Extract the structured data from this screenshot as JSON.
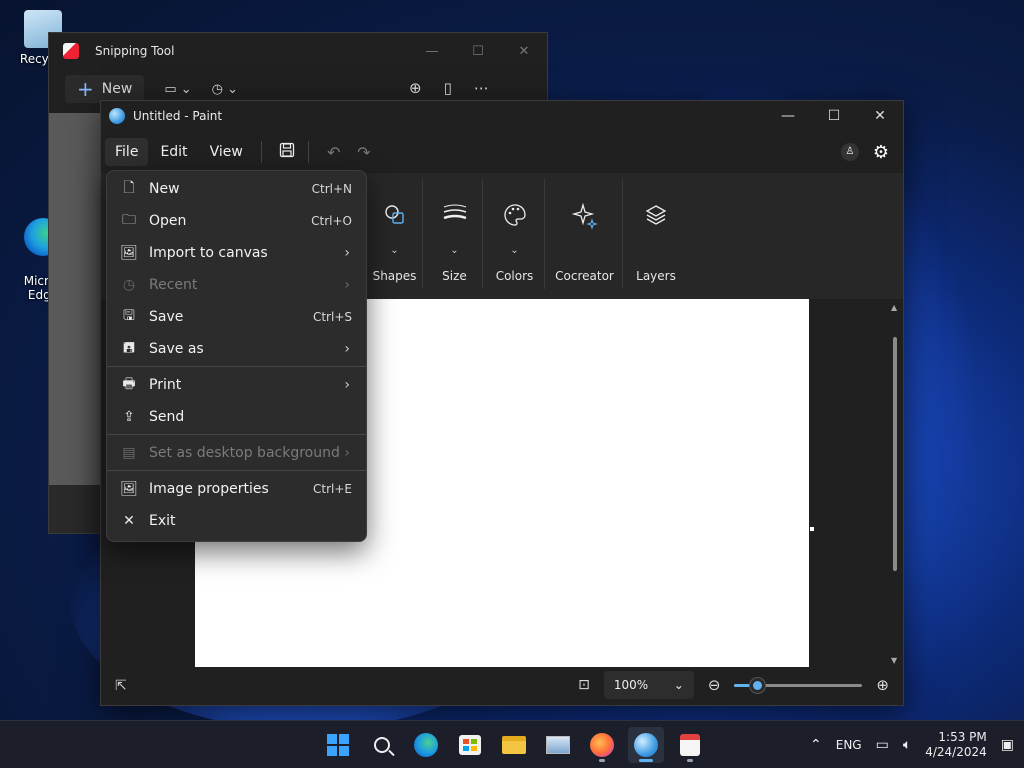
{
  "desktop": {
    "icons": [
      {
        "label": "Recycle"
      },
      {
        "label": "Micros\nEdge"
      }
    ]
  },
  "snipping_tool": {
    "title": "Snipping Tool",
    "new_label": "New",
    "toolbar_icons": [
      "rectangle-snip-icon",
      "timer-icon",
      "zoom-in-icon",
      "copy-icon",
      "more-icon"
    ]
  },
  "paint": {
    "title": "Untitled - Paint",
    "menu": {
      "file": "File",
      "edit": "Edit",
      "view": "View"
    },
    "ribbon": [
      {
        "label": "Shapes",
        "icon": "shapes-icon"
      },
      {
        "label": "Size",
        "icon": "brush-size-icon"
      },
      {
        "label": "Colors",
        "icon": "palette-icon"
      },
      {
        "label": "Cocreator",
        "icon": "sparkle-icon"
      },
      {
        "label": "Layers",
        "icon": "layers-icon"
      }
    ],
    "zoom": {
      "value": "100%",
      "slider_fraction": 0.18
    },
    "file_menu": [
      {
        "label": "New",
        "shortcut": "Ctrl+N",
        "icon": "new-file-icon",
        "submenu": false,
        "disabled": false
      },
      {
        "label": "Open",
        "shortcut": "Ctrl+O",
        "icon": "folder-icon",
        "submenu": false,
        "disabled": false
      },
      {
        "label": "Import to canvas",
        "shortcut": "",
        "icon": "import-image-icon",
        "submenu": true,
        "disabled": false
      },
      {
        "label": "Recent",
        "shortcut": "",
        "icon": "clock-icon",
        "submenu": true,
        "disabled": true
      },
      {
        "label": "Save",
        "shortcut": "Ctrl+S",
        "icon": "save-icon",
        "submenu": false,
        "disabled": false
      },
      {
        "label": "Save as",
        "shortcut": "",
        "icon": "save-as-icon",
        "submenu": true,
        "disabled": false
      },
      {
        "label": "Print",
        "shortcut": "",
        "icon": "printer-icon",
        "submenu": true,
        "disabled": false
      },
      {
        "label": "Send",
        "shortcut": "",
        "icon": "share-icon",
        "submenu": false,
        "disabled": false
      },
      {
        "label": "Set as desktop background",
        "shortcut": "",
        "icon": "desktop-background-icon",
        "submenu": true,
        "disabled": true
      },
      {
        "label": "Image properties",
        "shortcut": "Ctrl+E",
        "icon": "image-properties-icon",
        "submenu": false,
        "disabled": false
      },
      {
        "label": "Exit",
        "shortcut": "",
        "icon": "close-icon",
        "submenu": false,
        "disabled": false
      }
    ]
  },
  "taskbar": {
    "language": "ENG",
    "time": "1:53 PM",
    "date": "4/24/2024"
  }
}
